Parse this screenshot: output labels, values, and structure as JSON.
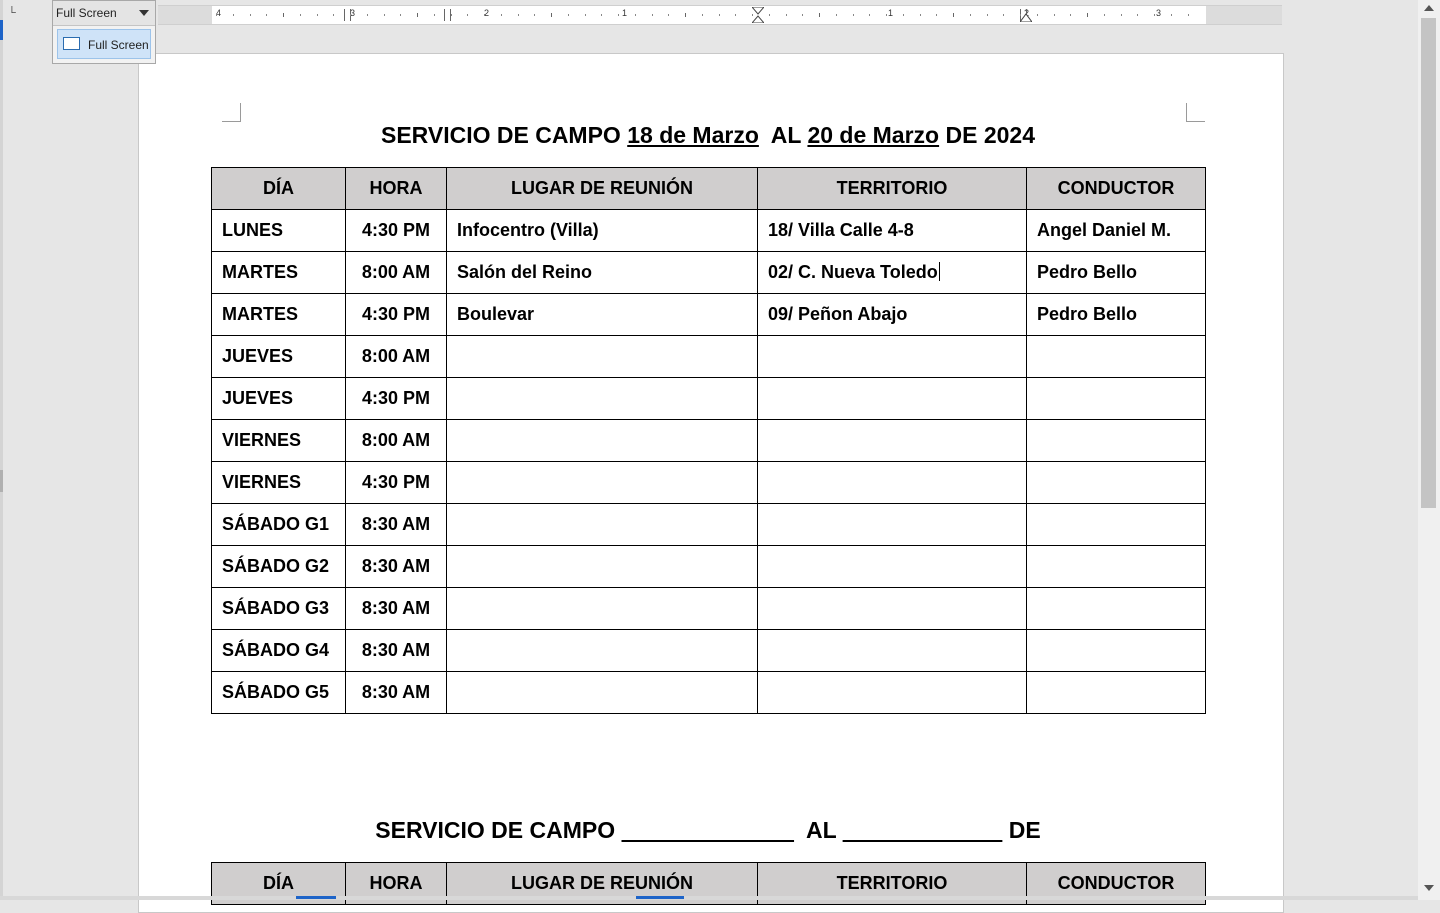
{
  "view_dropdown": {
    "selected": "Full Screen",
    "item_label": "Full Screen"
  },
  "ruler": {
    "numbers": [
      "4",
      "3",
      "2",
      "1",
      "1",
      "2",
      "3"
    ]
  },
  "page1": {
    "title": {
      "prefix": "SERVICIO DE CAMPO ",
      "start_date": "18 de Marzo",
      "middle": "  AL ",
      "end_date": "20 de Marzo",
      "suffix": " DE 2024"
    },
    "headers": [
      "DÍA",
      "HORA",
      "LUGAR DE REUNIÓN",
      "TERRITORIO",
      "CONDUCTOR"
    ],
    "rows": [
      {
        "dia": "LUNES",
        "hora": "4:30 PM",
        "lugar": "Infocentro (Villa)",
        "territorio": "18/ Villa Calle 4-8",
        "conductor": "Angel Daniel M."
      },
      {
        "dia": "MARTES",
        "hora": "8:00 AM",
        "lugar": "Salón del Reino",
        "territorio": "02/ C. Nueva Toledo",
        "conductor": "Pedro Bello"
      },
      {
        "dia": "MARTES",
        "hora": "4:30 PM",
        "lugar": "Boulevar",
        "territorio": "09/ Peñon Abajo",
        "conductor": "Pedro Bello"
      },
      {
        "dia": "JUEVES",
        "hora": "8:00 AM",
        "lugar": "",
        "territorio": "",
        "conductor": ""
      },
      {
        "dia": "JUEVES",
        "hora": "4:30 PM",
        "lugar": "",
        "territorio": "",
        "conductor": ""
      },
      {
        "dia": "VIERNES",
        "hora": "8:00 AM",
        "lugar": "",
        "territorio": "",
        "conductor": ""
      },
      {
        "dia": "VIERNES",
        "hora": "4:30 PM",
        "lugar": "",
        "territorio": "",
        "conductor": ""
      },
      {
        "dia": "SÁBADO G1",
        "hora": "8:30 AM",
        "lugar": "",
        "territorio": "",
        "conductor": ""
      },
      {
        "dia": "SÁBADO G2",
        "hora": "8:30 AM",
        "lugar": "",
        "territorio": "",
        "conductor": ""
      },
      {
        "dia": "SÁBADO G3",
        "hora": "8:30 AM",
        "lugar": "",
        "territorio": "",
        "conductor": ""
      },
      {
        "dia": "SÁBADO G4",
        "hora": "8:30 AM",
        "lugar": "",
        "territorio": "",
        "conductor": ""
      },
      {
        "dia": "SÁBADO G5",
        "hora": "8:30 AM",
        "lugar": "",
        "territorio": "",
        "conductor": ""
      }
    ]
  },
  "page2": {
    "title": {
      "prefix": "SERVICIO DE CAMPO ",
      "blank1": "                           ",
      "middle": "  AL ",
      "blank2": "                         ",
      "suffix": " DE"
    },
    "headers": [
      "DÍA",
      "HORA",
      "LUGAR DE REUNIÓN",
      "TERRITORIO",
      "CONDUCTOR"
    ]
  },
  "colors": {
    "header_fill": "#d0cece",
    "accent": "#1e64c8"
  }
}
